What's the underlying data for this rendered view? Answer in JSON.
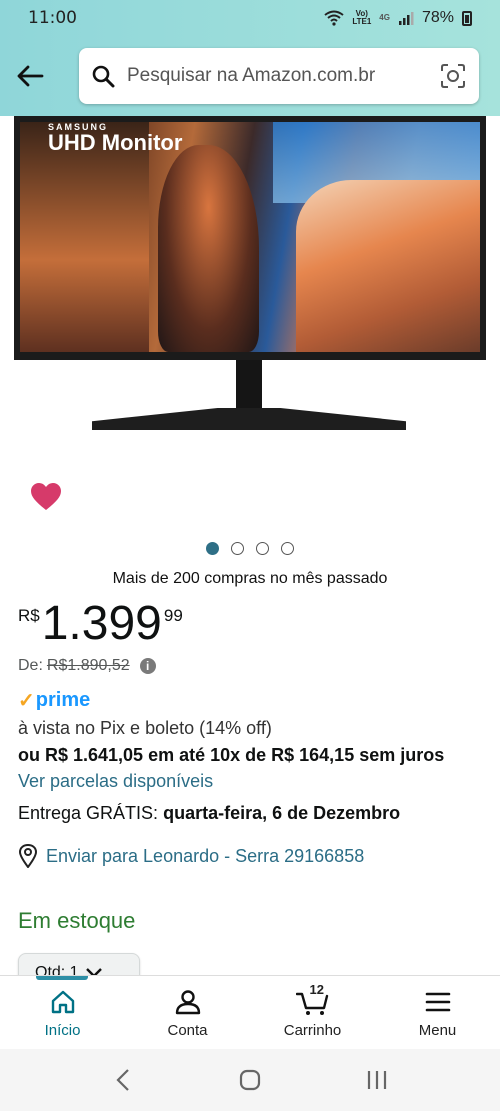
{
  "status": {
    "time": "11:00",
    "net_small": "Vo)",
    "net_tiny": "LTE1",
    "net_type": "4G",
    "battery": "78%"
  },
  "search": {
    "placeholder": "Pesquisar na Amazon.com.br"
  },
  "product": {
    "brand": "SAMSUNG",
    "model_text": "UHD Monitor",
    "image_count": 4,
    "active_image": 1,
    "bought_text": "Mais de 200 compras no mês passado",
    "price_symbol": "R$",
    "price_whole": "1.399",
    "price_cents": "99",
    "list_price_label": "De:",
    "list_price": "R$1.890,52",
    "prime_text": "prime",
    "pix_text": "à vista no Pix e boleto (14% off)",
    "installments_text": "ou R$ 1.641,05 em até 10x de R$ 164,15 sem juros",
    "see_installments": "Ver parcelas disponíveis",
    "delivery_prefix": "Entrega GRÁTIS:",
    "delivery_date": "quarta-feira, 6 de Dezembro",
    "ship_to": "Enviar para Leonardo - Serra 29166858",
    "stock": "Em estoque",
    "qty_label": "Qtd: 1"
  },
  "nav": {
    "items": [
      {
        "label": "Início",
        "icon": "home-icon"
      },
      {
        "label": "Conta",
        "icon": "user-icon"
      },
      {
        "label": "Carrinho",
        "icon": "cart-icon"
      },
      {
        "label": "Menu",
        "icon": "menu-icon"
      }
    ],
    "cart_count": "12"
  },
  "colors": {
    "header": "#8fd6d9",
    "link": "#2b6d86",
    "stock": "#2e7d32",
    "heart": "#d63a6a",
    "prime": "#1a98ff"
  }
}
